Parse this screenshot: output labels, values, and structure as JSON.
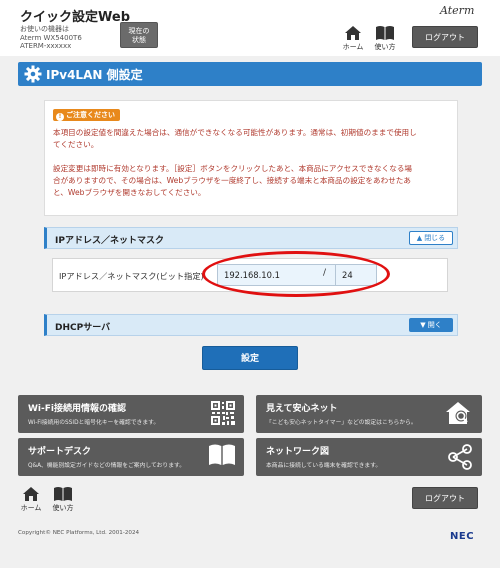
{
  "header": {
    "app_title": "クイック設定Web",
    "device_line1": "お使いの機器は",
    "device_line2": "Aterm WX5400T6",
    "device_line3": "ATERM-xxxxxx",
    "status_button_line1": "現在の",
    "status_button_line2": "状態",
    "brand": "Aterm",
    "home_label": "ホーム",
    "howto_label": "使い方",
    "logout_label": "ログアウト"
  },
  "page": {
    "title": "IPv4LAN 側設定"
  },
  "caution": {
    "badge": "ご注意ください",
    "badge_mark": "!",
    "lines_a": [
      "本項目の設定値を間違えた場合は、通信ができなくなる可能性があります。通常は、初期値のままで使用し",
      "てください。"
    ],
    "lines_b": [
      "設定変更は即時に有効となります。［設定］ボタンをクリックしたあと、本商品にアクセスできなくなる場",
      "合がありますので、その場合は、Webブラウザを一度終了し、接続する端末と本商品の設定をあわせたあ",
      "と、Webブラウザを開きなおしてください。"
    ]
  },
  "ip_section": {
    "title": "IPアドレス／ネットマスク",
    "toggle_label": "閉じる",
    "field_label": "IPアドレス／ネットマスク(ビット指定)",
    "ip_value": "192.168.10.1",
    "separator": "/",
    "mask_value": "24"
  },
  "dhcp_section": {
    "title": "DHCPサーバ",
    "toggle_label": "開く"
  },
  "actions": {
    "set_label": "設定"
  },
  "tiles": [
    {
      "title": "Wi-Fi接続用情報の確認",
      "desc": "Wi-Fi接続用のSSIDと暗号化キーを確認できます。",
      "icon": "qr-code-icon"
    },
    {
      "title": "見えて安心ネット",
      "desc": "「こども安心ネットタイマー」などの設定はこちらから。",
      "icon": "home-search-icon"
    },
    {
      "title": "サポートデスク",
      "desc": "Q&A、機能別設定ガイドなどの情報をご案内しております。",
      "icon": "book-icon"
    },
    {
      "title": "ネットワーク図",
      "desc": "本商品に接続している端末を確認できます。",
      "icon": "share-network-icon"
    }
  ],
  "footer": {
    "home_label": "ホーム",
    "howto_label": "使い方",
    "logout_label": "ログアウト",
    "copyright": "Copyright© NEC Platforms, Ltd. 2001-2024",
    "company": "NEC"
  },
  "colors": {
    "accent_blue": "#2e80c8",
    "caution_orange": "#e8891c",
    "caution_text": "#b03a2e",
    "tile_gray": "#5b5b5b",
    "highlight_red": "#e01010"
  }
}
